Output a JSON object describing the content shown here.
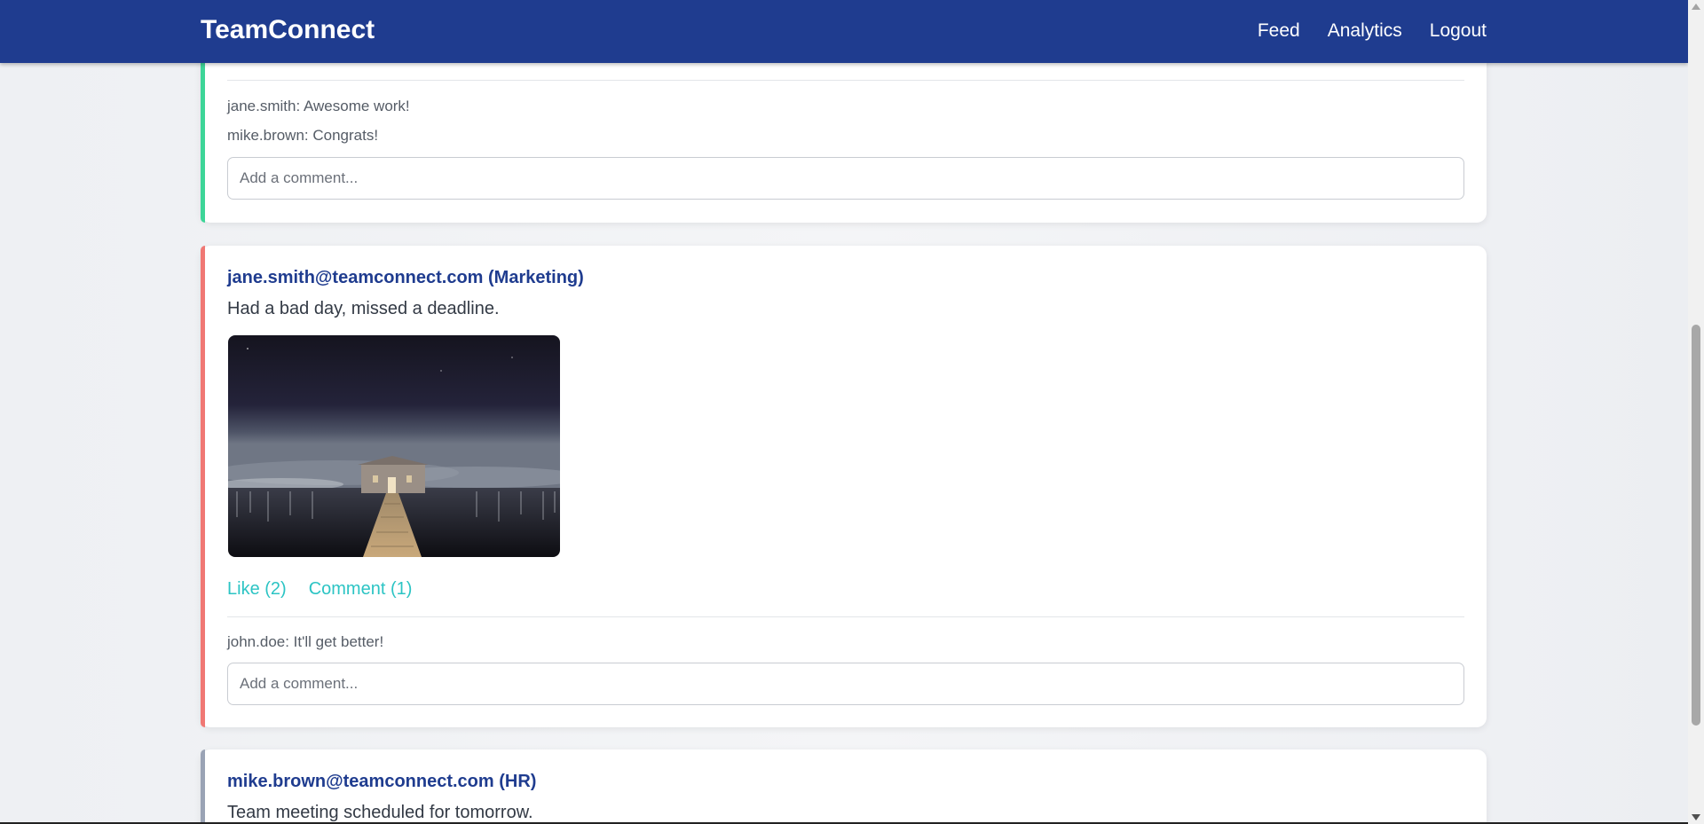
{
  "nav": {
    "brand": "TeamConnect",
    "links": [
      "Feed",
      "Analytics",
      "Logout"
    ]
  },
  "posts": [
    {
      "accent_color": "#3dd598",
      "comments": [
        "jane.smith: Awesome work!",
        "mike.brown: Congrats!"
      ],
      "comment_placeholder": "Add a comment..."
    },
    {
      "accent_color": "#f07874",
      "author": "jane.smith@teamconnect.com (Marketing)",
      "content": "Had a bad day, missed a deadline.",
      "image": "night-boathouse-pier-photo",
      "like_label": "Like (2)",
      "comment_label": "Comment (1)",
      "comments": [
        "john.doe: It'll get better!"
      ],
      "comment_placeholder": "Add a comment..."
    },
    {
      "accent_color": "#9aa3b5",
      "author": "mike.brown@teamconnect.com (HR)",
      "content": "Team meeting scheduled for tomorrow."
    }
  ],
  "colors": {
    "navbar": "#1f3c8f",
    "author": "#1f3c8f",
    "action": "#2cc4c4"
  }
}
